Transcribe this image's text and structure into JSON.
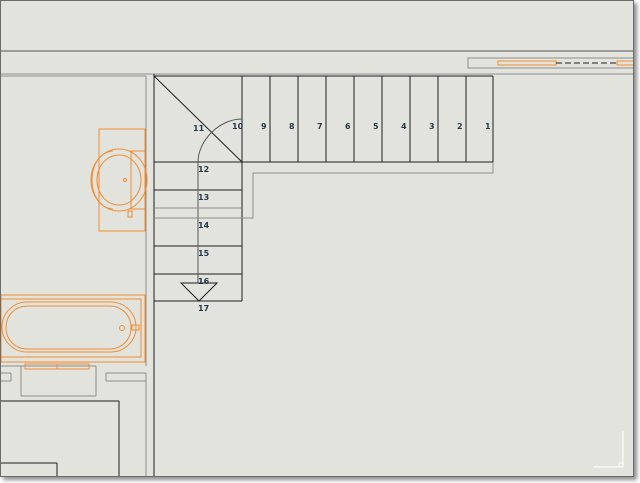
{
  "drawing": {
    "stair_step_labels": [
      "1",
      "2",
      "3",
      "4",
      "5",
      "6",
      "7",
      "8",
      "9",
      "10",
      "11",
      "12",
      "13",
      "14",
      "15",
      "16",
      "17"
    ]
  },
  "colors": {
    "background": "#e3e3de",
    "wall_line": "#1e1e1e",
    "thin_line": "#8c8c8c",
    "fixture_orange": "#f08c30",
    "label_text": "#24384a",
    "coordinate_axis": "#ffffff"
  },
  "icons": {
    "coordinate_axis": "ucs-axis-icon",
    "stair_arrow": "arrow-down-icon",
    "sink": "washbasin-icon",
    "bathtub": "bathtub-icon"
  }
}
